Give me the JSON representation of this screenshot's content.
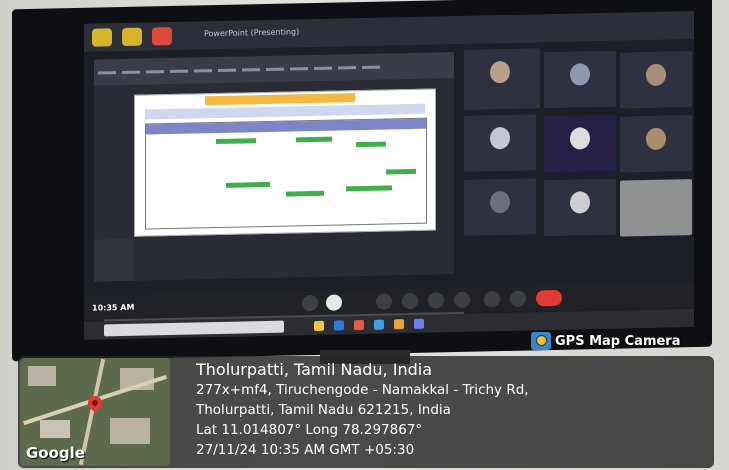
{
  "meeting": {
    "window_title": "PowerPoint (Presenting)",
    "time": "10:35 AM"
  },
  "badge": {
    "label": "GPS Map Camera",
    "icon": "gps-map-camera-icon"
  },
  "map": {
    "brand": "Google"
  },
  "location": {
    "place": "Tholurpatti, Tamil Nadu, India",
    "address_line1": "277x+mf4, Tiruchengode - Namakkal - Trichy Rd,",
    "address_line2": "Tholurpatti, Tamil Nadu 621215, India",
    "coordinates": "Lat 11.014807° Long 78.297867°",
    "timestamp": "27/11/24 10:35 AM GMT +05:30"
  },
  "colors": {
    "end_call": "#e53935",
    "slide_banner": "#f4b942",
    "gps_icon": "#3b86c8"
  }
}
